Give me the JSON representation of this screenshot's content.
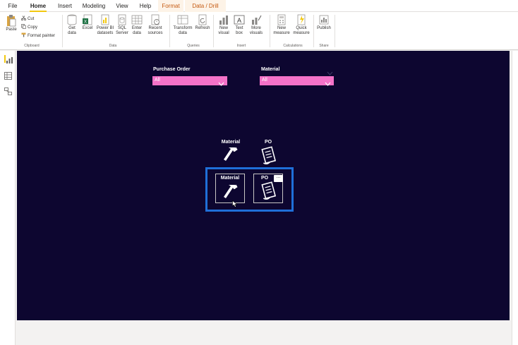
{
  "menu": {
    "tabs": [
      {
        "label": "File"
      },
      {
        "label": "Home"
      },
      {
        "label": "Insert"
      },
      {
        "label": "Modeling"
      },
      {
        "label": "View"
      },
      {
        "label": "Help"
      },
      {
        "label": "Format"
      },
      {
        "label": "Data / Drill"
      }
    ],
    "active": "Home"
  },
  "ribbon": {
    "clipboard": {
      "paste": "Paste",
      "cut": "Cut",
      "copy": "Copy",
      "format_painter": "Format painter",
      "label": "Clipboard"
    },
    "data": {
      "get_data": "Get data",
      "excel": "Excel",
      "powerbi": "Power BI datasets",
      "sql": "SQL Server",
      "enter": "Enter data",
      "recent": "Recent sources",
      "label": "Data"
    },
    "queries": {
      "transform": "Transform data",
      "refresh": "Refresh",
      "label": "Queries"
    },
    "insert": {
      "new_visual": "New visual",
      "text_box": "Text box",
      "more_visuals": "More visuals",
      "label": "Insert"
    },
    "calculations": {
      "new_measure": "New measure",
      "quick_measure": "Quick measure",
      "label": "Calculations"
    },
    "share": {
      "publish": "Publish",
      "label": "Share"
    }
  },
  "canvas": {
    "slicer_po": {
      "title": "Purchase Order",
      "value": "All"
    },
    "slicer_material": {
      "title": "Material",
      "value": "All"
    },
    "icons_top": {
      "material_label": "Material",
      "po_label": "PO"
    },
    "icons_selected": {
      "material_label": "Material",
      "po_label": "PO"
    },
    "more_options": "..."
  },
  "colors": {
    "canvas_bg": "#0d0630",
    "slicer_bg": "#f472c8",
    "selection": "#1f6fd8",
    "accent": "#f2c811"
  },
  "icons": [
    "paste-icon",
    "cut-icon",
    "copy-icon",
    "format-painter-icon",
    "database-icon",
    "excel-icon",
    "hammer-icon",
    "document-icon",
    "report-view-icon",
    "table-view-icon",
    "model-view-icon"
  ]
}
